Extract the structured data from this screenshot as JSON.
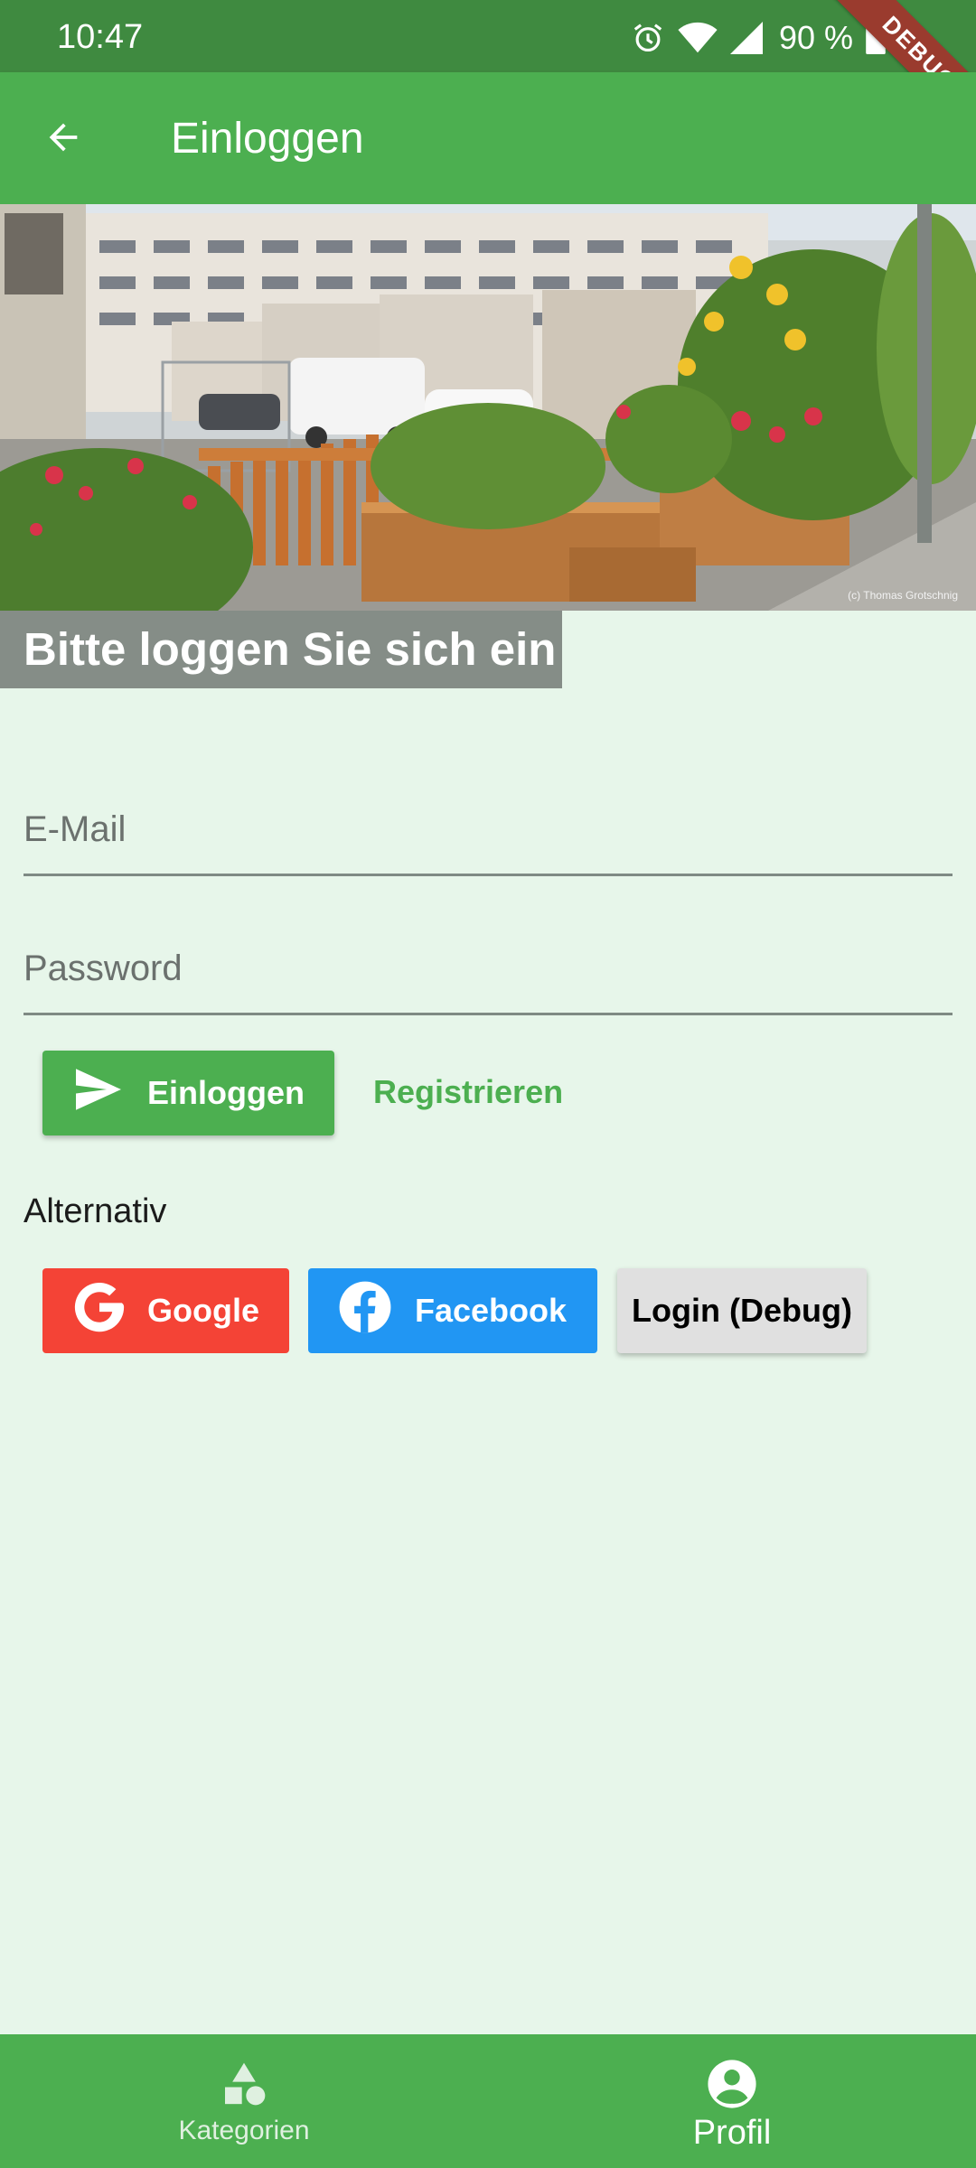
{
  "status_bar": {
    "time": "10:47",
    "battery": "90 %",
    "debug_banner": "DEBUG"
  },
  "app_bar": {
    "title": "Einloggen",
    "back_icon": "arrow-back-icon"
  },
  "hero": {
    "credit": "(c) Thomas Grotschnig"
  },
  "heading": "Bitte loggen Sie sich ein",
  "form": {
    "email_placeholder": "E-Mail",
    "email_value": "",
    "password_placeholder": "Password",
    "password_value": ""
  },
  "actions": {
    "login_label": "Einloggen",
    "login_icon": "send-icon",
    "register_label": "Registrieren"
  },
  "alternative": {
    "label": "Alternativ",
    "google_label": "Google",
    "facebook_label": "Facebook",
    "debug_label": "Login (Debug)"
  },
  "bottom_nav": {
    "items": [
      {
        "label": "Kategorien",
        "icon": "category-icon",
        "active": false
      },
      {
        "label": "Profil",
        "icon": "account-circle-icon",
        "active": true
      }
    ]
  },
  "colors": {
    "primary": "#4caf50",
    "status_bar": "#3f8a40",
    "background": "#e7f6ea",
    "google": "#f44336",
    "facebook": "#2196f3"
  }
}
